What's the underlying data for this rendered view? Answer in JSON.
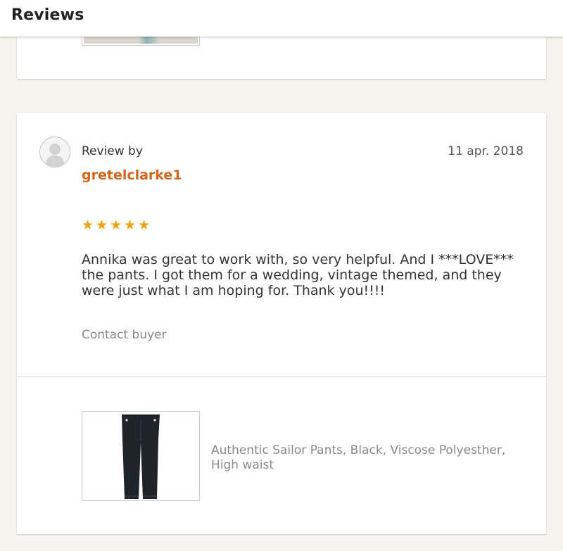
{
  "header": {
    "title": "Reviews"
  },
  "review": {
    "label": "Review by",
    "username": "gretelclarke1",
    "date": "11 apr. 2018",
    "stars": "★★★★★",
    "rating": 5,
    "text": "Annika was great to work with, so very helpful. And I ***LOVE*** the pants. I got them for a wedding, vintage themed, and they were just what I am hoping for. Thank you!!!!",
    "contact_label": "Contact buyer"
  },
  "product": {
    "title": "Authentic Sailor Pants, Black, Viscose Polyesther, High waist"
  },
  "icons": {
    "avatar": "user-avatar-icon",
    "star": "star-icon"
  },
  "colors": {
    "username": "#d5641c",
    "stars": "#f1a10d",
    "muted_text": "#8a8a8a",
    "background": "#f5f4ef"
  }
}
